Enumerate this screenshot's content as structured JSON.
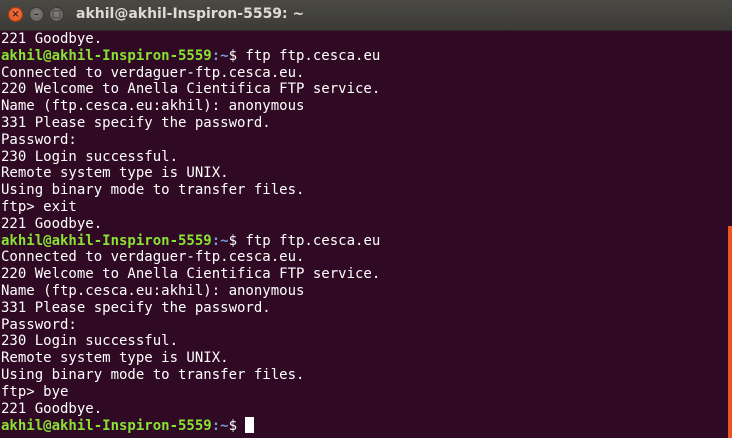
{
  "window": {
    "title": "akhil@akhil-Inspiron-5559: ~",
    "close_glyph": "×",
    "minimize_glyph": "–",
    "maximize_glyph": "□"
  },
  "terminal": {
    "prompt_user_host": "akhil@akhil-Inspiron-5559",
    "prompt_path": ":~",
    "lines": [
      "221 Goodbye.",
      "$ ftp ftp.cesca.eu",
      "Connected to verdaguer-ftp.cesca.eu.",
      "220 Welcome to Anella Cientifica FTP service.",
      "Name (ftp.cesca.eu:akhil): anonymous",
      "331 Please specify the password.",
      "Password:",
      "230 Login successful.",
      "Remote system type is UNIX.",
      "Using binary mode to transfer files.",
      "ftp> exit",
      "221 Goodbye.",
      "$ ftp ftp.cesca.eu",
      "Connected to verdaguer-ftp.cesca.eu.",
      "220 Welcome to Anella Cientifica FTP service.",
      "Name (ftp.cesca.eu:akhil): anonymous",
      "331 Please specify the password.",
      "Password:",
      "230 Login successful.",
      "Remote system type is UNIX.",
      "Using binary mode to transfer files.",
      "ftp> bye",
      "221 Goodbye.",
      "$ "
    ],
    "colors": {
      "background": "#300a24",
      "prompt_user": "#8ae234",
      "prompt_path": "#729fcf",
      "scrollbar": "#e95420"
    }
  }
}
